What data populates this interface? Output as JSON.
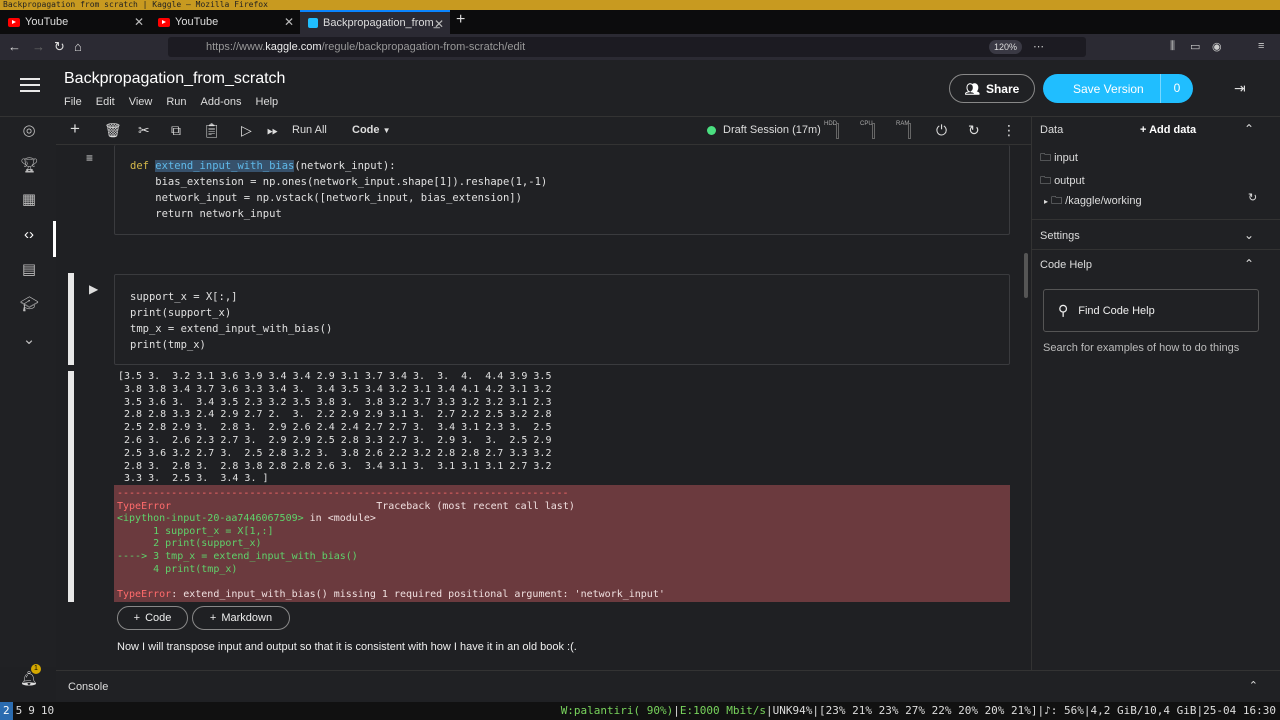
{
  "os": {
    "title": "Backpropagation from scratch | Kaggle — Mozilla Firefox"
  },
  "browser": {
    "tabs": [
      {
        "label": "YouTube"
      },
      {
        "label": "YouTube"
      },
      {
        "label": "Backpropagation_from_"
      }
    ],
    "url_prefix": "https://www.",
    "url_host": "kaggle.com",
    "url_path": "/regule/backpropagation-from-scratch/edit",
    "zoom": "120%"
  },
  "header": {
    "title": "Backpropagation_from_scratch",
    "menu": [
      "File",
      "Edit",
      "View",
      "Run",
      "Add-ons",
      "Help"
    ],
    "share_label": "Share",
    "save_label": "Save Version",
    "save_count": "0"
  },
  "toolbar": {
    "run_all": "Run All",
    "cell_type": "Code",
    "session": "Draft Session (17m)",
    "meters": [
      "HDD",
      "CPU",
      "RAM"
    ]
  },
  "cells": {
    "def_code": [
      "def extend_input_with_bias(network_input):",
      "    bias_extension = np.ones(network_input.shape[1]).reshape(1,-1)",
      "    network_input = np.vstack([network_input, bias_extension])",
      "    return network_input"
    ],
    "active_code": [
      "support_x = X[:,]",
      "print(support_x)",
      "tmp_x = extend_input_with_bias()",
      "print(tmp_x)"
    ],
    "output_lines": [
      "[3.5 3.  3.2 3.1 3.6 3.9 3.4 3.4 2.9 3.1 3.7 3.4 3.  3.  4.  4.4 3.9 3.5",
      " 3.8 3.8 3.4 3.7 3.6 3.3 3.4 3.  3.4 3.5 3.4 3.2 3.1 3.4 4.1 4.2 3.1 3.2",
      " 3.5 3.6 3.  3.4 3.5 2.3 3.2 3.5 3.8 3.  3.8 3.2 3.7 3.3 3.2 3.2 3.1 2.3",
      " 2.8 2.8 3.3 2.4 2.9 2.7 2.  3.  2.2 2.9 2.9 3.1 3.  2.7 2.2 2.5 3.2 2.8",
      " 2.5 2.8 2.9 3.  2.8 3.  2.9 2.6 2.4 2.4 2.7 2.7 3.  3.4 3.1 2.3 3.  2.5",
      " 2.6 3.  2.6 2.3 2.7 3.  2.9 2.9 2.5 2.8 3.3 2.7 3.  2.9 3.  3.  2.5 2.9",
      " 2.5 3.6 3.2 2.7 3.  2.5 2.8 3.2 3.  3.8 2.6 2.2 3.2 2.8 2.8 2.7 3.3 3.2",
      " 2.8 3.  2.8 3.  2.8 3.8 2.8 2.8 2.6 3.  3.4 3.1 3.  3.1 3.1 3.1 2.7 3.2",
      " 3.3 3.  2.5 3.  3.4 3. ]"
    ],
    "error": {
      "dashes": "---------------------------------------------------------------------------",
      "type": "TypeError",
      "traceback_label": "Traceback (most recent call last)",
      "input_ref": "<ipython-input-20-aa7446067509>",
      "in_module": " in <module>",
      "lines": [
        "      1 support_x = X[1,:]",
        "      2 print(support_x)",
        "----> 3 tmp_x = extend_input_with_bias()",
        "      4 print(tmp_x)"
      ],
      "final_type": "TypeError",
      "final_msg": ": extend_input_with_bias() missing 1 required positional argument: 'network_input'"
    },
    "add_code": "Code",
    "add_markdown": "Markdown",
    "markdown_text": "Now I will transpose input and output so that it is consistent with how I have it in an old book :(."
  },
  "right_panel": {
    "data_label": "Data",
    "add_data": "Add data",
    "input": "input",
    "output": "output",
    "working": "/kaggle/working",
    "settings": "Settings",
    "code_help": "Code Help",
    "find_code_help": "Find Code Help",
    "search_hint": "Search for examples of how to do things"
  },
  "console": {
    "label": "Console",
    "badge": "1"
  },
  "statusbar": {
    "workspaces": [
      "2",
      "5",
      "9",
      "10"
    ],
    "wifi": "W:palantiri( 90%)",
    "eth": "E:1000 Mbit/s",
    "unk": "UNK94%",
    "cpu": "[23% 21% 23% 27% 22% 20% 20% 21%]",
    "vol": "♪: 56%",
    "mem": "4,2 GiB/10,4 GiB",
    "date": "25-04 16:30"
  }
}
